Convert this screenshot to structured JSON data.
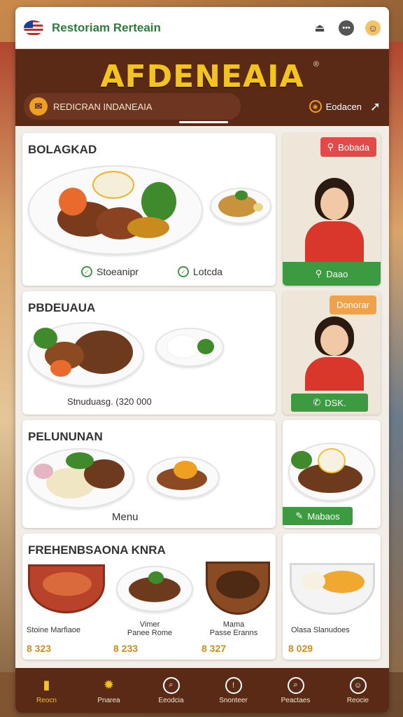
{
  "app": {
    "title": "Restoriam Rerteain",
    "brand": "AFDENEAIA",
    "brand_reg": "®"
  },
  "header": {
    "search_label": "REDICRAN INDANEAIA",
    "location_label": "Eodacen"
  },
  "cards": {
    "main1": {
      "title": "BOLAGKAD",
      "meta": [
        {
          "icon": "leaf-icon",
          "label": "Stoeanipr"
        },
        {
          "icon": "check-icon",
          "label": "Lotcda"
        }
      ]
    },
    "main2": {
      "title": "PBDEUAUA",
      "caption": "Stnuduasg. (320 000"
    },
    "main3": {
      "title": "PELUNUNAN",
      "caption": "Menu"
    },
    "main4": {
      "title": "FREHENBSAONA KNRA",
      "dishes": [
        {
          "label": "Stoine Marfiaoe",
          "price": "8 323"
        },
        {
          "label": "Vimer\nPanee Rome",
          "price": "8 233"
        },
        {
          "label": "Mama\nPasse Eranns",
          "price": "8 327"
        }
      ]
    },
    "side1": {
      "badge": "Bobada",
      "button": "Daao"
    },
    "side2": {
      "badge": "Donorar",
      "button": "DSK."
    },
    "side3": {
      "button": "Mabaos"
    },
    "side4": {
      "label": "Olasa Slanudoes",
      "price": "8 029"
    }
  },
  "bottom_nav": [
    {
      "icon": "home-icon",
      "label": "Reocn"
    },
    {
      "icon": "sun-icon",
      "label": "Pnarea"
    },
    {
      "icon": "search-icon",
      "label": "Eeodcia"
    },
    {
      "icon": "info-icon",
      "label": "Snonteer"
    },
    {
      "icon": "magnifier-icon",
      "label": "Peactaes"
    },
    {
      "icon": "profile-icon",
      "label": "Reocie"
    }
  ],
  "colors": {
    "brand_brown": "#5a2a16",
    "accent_yellow": "#f3c41f",
    "green": "#3c9a40",
    "red_badge": "#e24a4a",
    "orange_badge": "#efa24a",
    "price": "#d18b1c"
  }
}
